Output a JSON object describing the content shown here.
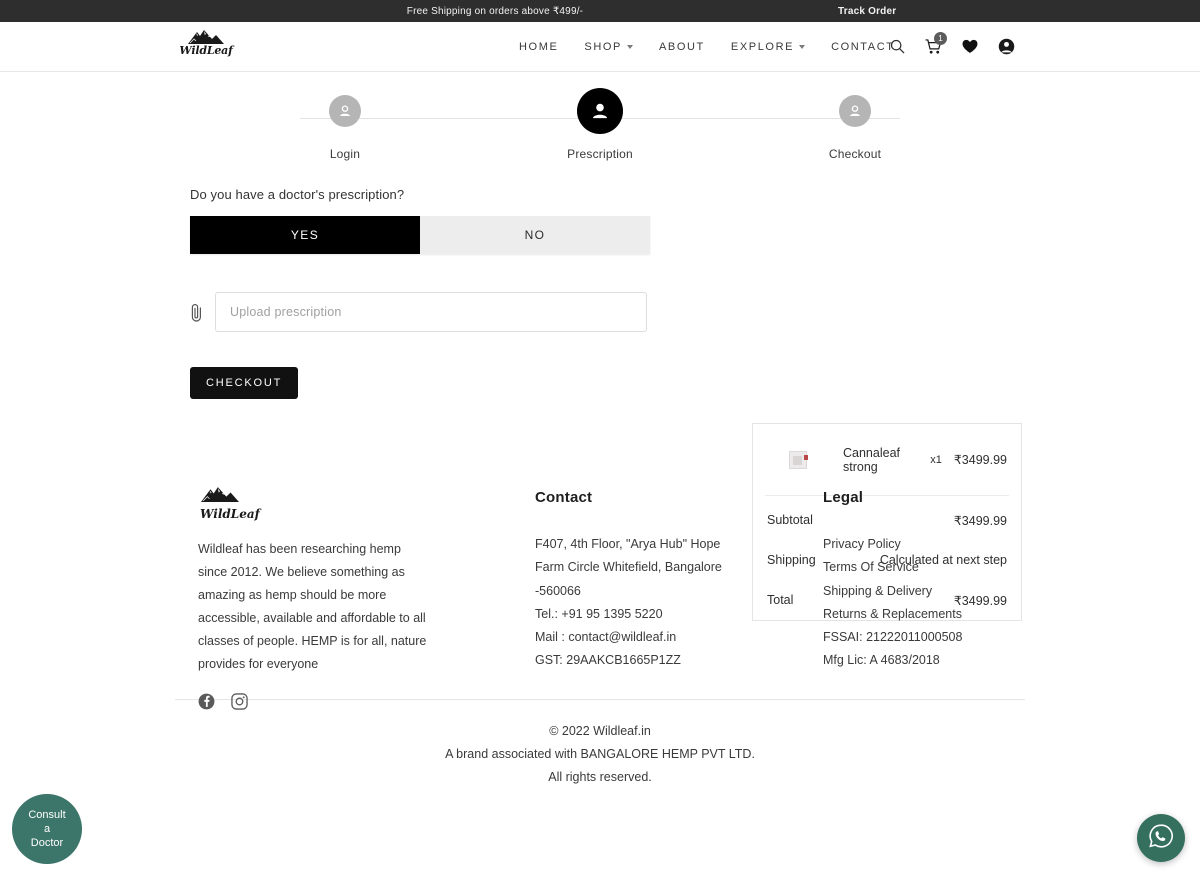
{
  "announcement": {
    "message": "Free Shipping on orders above ₹499/-",
    "track_order": "Track Order"
  },
  "header": {
    "logo_word": "WildLeaf",
    "nav": [
      {
        "label": "HOME",
        "has_caret": false
      },
      {
        "label": "SHOP",
        "has_caret": true
      },
      {
        "label": "ABOUT",
        "has_caret": false
      },
      {
        "label": "EXPLORE",
        "has_caret": true
      },
      {
        "label": "CONTACT",
        "has_caret": false
      }
    ],
    "icons": [
      "search-icon",
      "cart-icon",
      "wishlist-heart-icon",
      "account-icon"
    ],
    "cart_count": "1"
  },
  "stepper": {
    "steps": [
      {
        "label": "Login",
        "active": false
      },
      {
        "label": "Prescription",
        "active": true
      },
      {
        "label": "Checkout",
        "active": false
      }
    ]
  },
  "prescription": {
    "question": "Do you have a doctor's prescription?",
    "yes_label": "YES",
    "no_label": "NO",
    "selected": "YES",
    "upload_placeholder": "Upload prescription",
    "upload_value": "",
    "checkout_label": "CHECKOUT"
  },
  "summary": {
    "item": {
      "name": "Cannaleaf strong",
      "qty": "x1",
      "price": "₹3499.99"
    },
    "rows": [
      {
        "label": "Subtotal",
        "value": "₹3499.99"
      },
      {
        "label": "Shipping",
        "value": "Calculated at next step"
      },
      {
        "label": "Total",
        "value": "₹3499.99"
      }
    ]
  },
  "footer": {
    "logo_word": "WildLeaf",
    "description": "Wildleaf has been researching hemp since 2012. We believe something as amazing as hemp should be more accessible, available and affordable to all classes of people. HEMP is for all, nature provides for everyone",
    "social": [
      "facebook-icon",
      "instagram-icon"
    ],
    "contact": {
      "title": "Contact",
      "lines": [
        "F407, 4th Floor, \"Arya Hub\" Hope",
        "Farm Circle Whitefield, Bangalore",
        "-560066",
        "Tel.: +91 95 1395 5220",
        "Mail : contact@wildleaf.in",
        "GST: 29AAKCB1665P1ZZ"
      ]
    },
    "legal": {
      "title": "Legal",
      "links": [
        "Privacy Policy",
        "Terms Of Service",
        "Shipping & Delivery",
        "Returns & Replacements",
        "FSSAI: 21222011000508",
        "Mfg Lic: A 4683/2018"
      ]
    },
    "copyright": [
      "© 2022 Wildleaf.in",
      "A brand associated with BANGALORE HEMP PVT LTD.",
      "All rights reserved."
    ]
  },
  "floating": {
    "doctor_line1": "Consult",
    "doctor_line2": "a",
    "doctor_line3": "Doctor",
    "whatsapp_icon": "whatsapp-icon"
  },
  "colors": {
    "accent_dark": "#000000",
    "announce_bg": "#2e2e2e",
    "teal": "#3c7569",
    "whatsapp_green": "#35705f",
    "muted_step": "#b5b5b5"
  }
}
